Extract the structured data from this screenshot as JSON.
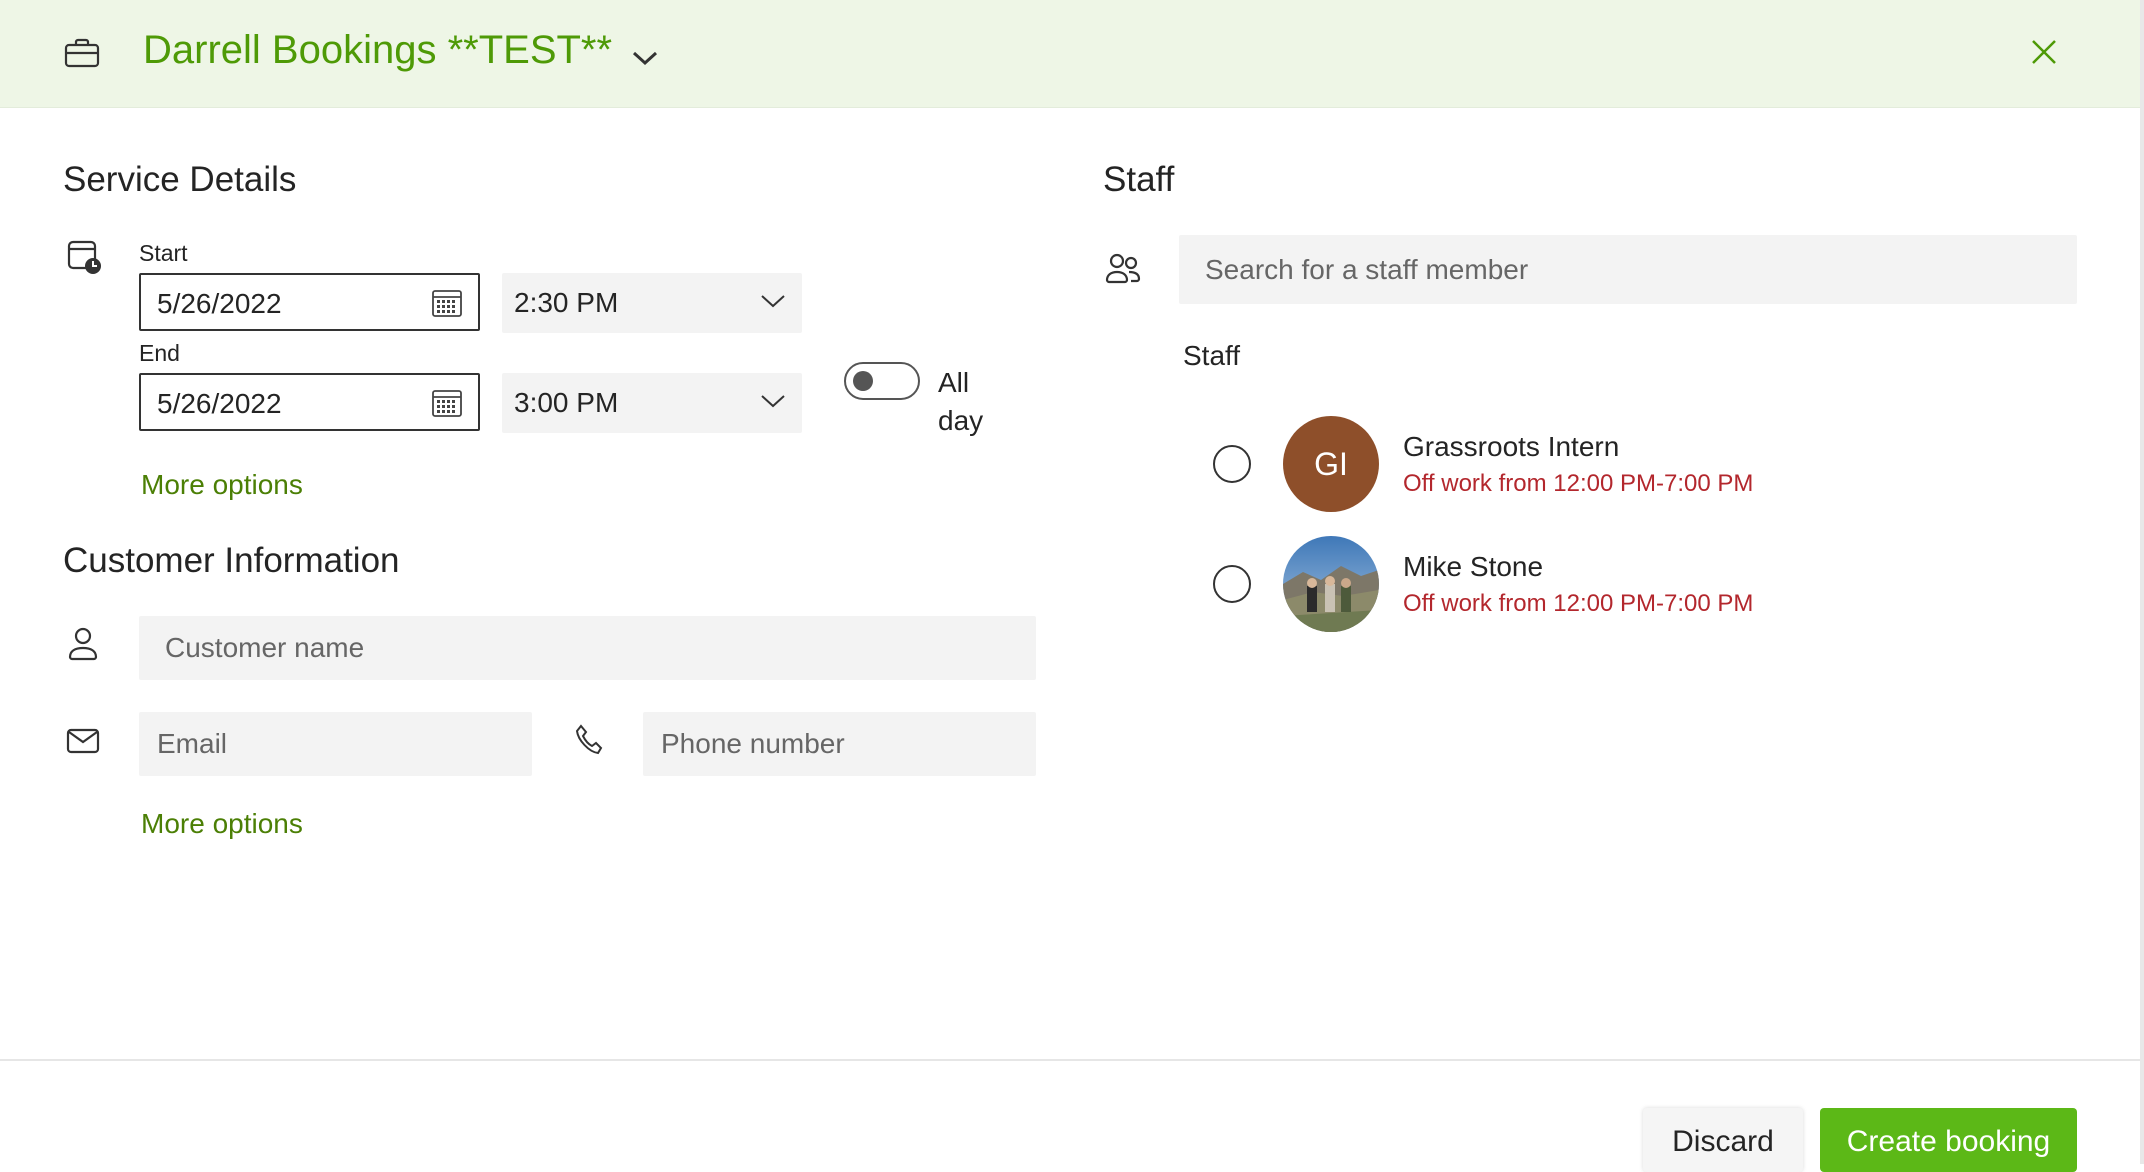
{
  "header": {
    "business_name": "Darrell Bookings **TEST**"
  },
  "service_details": {
    "title": "Service Details",
    "start_label": "Start",
    "start_date": "5/26/2022",
    "start_time": "2:30 PM",
    "end_label": "End",
    "end_date": "5/26/2022",
    "end_time": "3:00 PM",
    "all_day_label": "All day",
    "all_day_line1": "All",
    "all_day_line2": "day",
    "all_day_on": false,
    "more_options": "More options"
  },
  "customer_information": {
    "title": "Customer Information",
    "name_placeholder": "Customer name",
    "email_placeholder": "Email",
    "phone_placeholder": "Phone number",
    "more_options": "More options"
  },
  "staff": {
    "title": "Staff",
    "search_placeholder": "Search for a staff member",
    "list_label": "Staff",
    "members": [
      {
        "initials": "GI",
        "name": "Grassroots Intern",
        "status": "Off work from 12:00 PM-7:00 PM",
        "avatar_color": "#8e4f2a",
        "selected": false
      },
      {
        "name": "Mike Stone",
        "status": "Off work from 12:00 PM-7:00 PM",
        "avatar": "photo",
        "selected": false
      }
    ]
  },
  "footer": {
    "discard_label": "Discard",
    "create_label": "Create booking"
  },
  "colors": {
    "accent_green": "#4e9a06",
    "header_bg": "#eef6e6",
    "primary_button": "#5cb817",
    "status_red": "#b3272d"
  },
  "icons": [
    "briefcase-icon",
    "chevron-down-icon",
    "close-icon",
    "calendar-clock-icon",
    "calendar-icon",
    "person-icon",
    "mail-icon",
    "phone-icon",
    "people-icon"
  ]
}
